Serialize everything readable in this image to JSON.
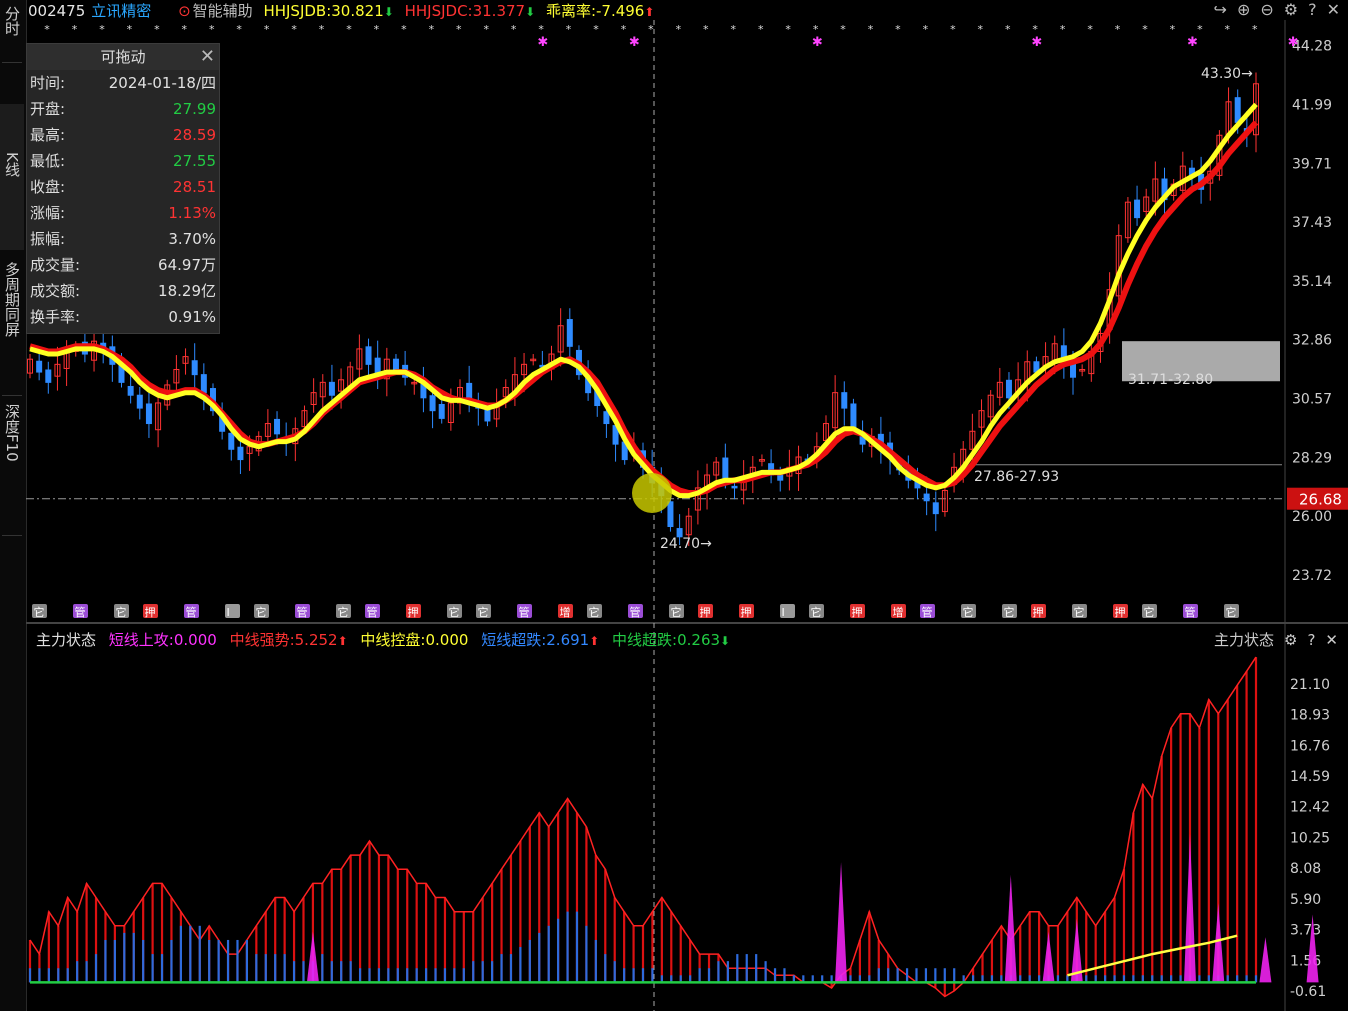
{
  "sidebar": {
    "tabs": [
      {
        "label": "分时"
      },
      {
        "label": "K线"
      },
      {
        "label": "多周期同屏"
      },
      {
        "label": "深度F10"
      }
    ]
  },
  "header": {
    "stock_code": "002475",
    "stock_name": "立讯精密",
    "assist_label": "智能辅助",
    "hhjsjdb": "HHJSJDB:30.821",
    "hhjsjdc": "HHJSJDC:31.377",
    "deviation": "乖离率:-7.496",
    "colors": {
      "code": "#e6e6e6",
      "name": "#2aa7ff",
      "db": "#ffff33",
      "dc": "#ff3333",
      "dev": "#ffff33"
    }
  },
  "info_panel": {
    "title": "可拖动",
    "rows": [
      {
        "label": "时间:",
        "value": "2024-01-18/四",
        "color": "#e0e0e0"
      },
      {
        "label": "开盘:",
        "value": "27.99",
        "color": "#22cc44"
      },
      {
        "label": "最高:",
        "value": "28.59",
        "color": "#ff3333"
      },
      {
        "label": "最低:",
        "value": "27.55",
        "color": "#22cc44"
      },
      {
        "label": "收盘:",
        "value": "28.51",
        "color": "#ff3333"
      },
      {
        "label": "涨幅:",
        "value": "1.13%",
        "color": "#ff3333"
      },
      {
        "label": "振幅:",
        "value": "3.70%",
        "color": "#e0e0e0"
      },
      {
        "label": "成交量:",
        "value": "64.97万",
        "color": "#e0e0e0"
      },
      {
        "label": "成交额:",
        "value": "18.29亿",
        "color": "#e0e0e0"
      },
      {
        "label": "换手率:",
        "value": "0.91%",
        "color": "#e0e0e0"
      }
    ]
  },
  "price_axis": [
    "44.28",
    "41.99",
    "39.71",
    "37.43",
    "35.14",
    "32.86",
    "30.57",
    "28.29",
    "26.00",
    "23.72"
  ],
  "current_price": "26.68",
  "annotations": {
    "high": "43.30",
    "low": "24.70",
    "zone_upper": "31.71-32.80",
    "zone_lower": "27.86-27.93"
  },
  "signal_tags": [
    "它",
    "管",
    "它",
    "押",
    "管",
    "I",
    "它",
    "管",
    "它",
    "管",
    "押",
    "它",
    "它",
    "管",
    "增",
    "它",
    "管",
    "它",
    "押",
    "押",
    "I",
    "它",
    "押",
    "增",
    "管",
    "它",
    "它",
    "押",
    "它",
    "押",
    "它",
    "管",
    "它"
  ],
  "indicator": {
    "name": "主力状态",
    "short_attack": "短线上攻:0.000",
    "mid_strong": "中线强势:5.252",
    "mid_control": "中线控盘:0.000",
    "short_oversold": "短线超跌:2.691",
    "mid_oversold": "中线超跌:0.263",
    "right_label": "主力状态",
    "axis": [
      "21.10",
      "18.93",
      "16.76",
      "14.59",
      "12.42",
      "10.25",
      "8.08",
      "5.90",
      "3.73",
      "1.56",
      "-0.61"
    ],
    "colors": {
      "name": "#e0e0e0",
      "short_attack": "#ff33ff",
      "mid_strong": "#ff3333",
      "mid_control": "#ffff33",
      "short_oversold": "#3388ff",
      "mid_oversold": "#22cc44"
    }
  },
  "chart_data": {
    "type": "candlestick",
    "ylim": [
      22.9,
      45.2
    ],
    "closes": [
      32.1,
      31.6,
      31.2,
      31.9,
      32.4,
      32.6,
      32.3,
      32.8,
      32.5,
      31.9,
      31.2,
      30.7,
      30.2,
      29.6,
      30.4,
      31.1,
      31.7,
      32.2,
      31.5,
      30.8,
      30.1,
      29.3,
      28.6,
      28.2,
      28.7,
      29.1,
      29.6,
      29.2,
      28.9,
      29.4,
      30.1,
      30.8,
      31.2,
      30.7,
      31.3,
      31.8,
      32.5,
      31.9,
      31.5,
      32.1,
      31.7,
      31.4,
      31.2,
      30.6,
      30.1,
      29.8,
      30.4,
      31.0,
      30.6,
      30.2,
      29.7,
      30.4,
      31.0,
      31.5,
      31.9,
      32.1,
      31.8,
      32.3,
      33.4,
      32.6,
      31.5,
      30.8,
      30.3,
      29.6,
      28.8,
      28.2,
      28.7,
      27.9,
      27.3,
      26.8,
      25.6,
      25.2,
      26.0,
      27.1,
      27.6,
      28.1,
      27.4,
      27.1,
      27.5,
      27.9,
      28.2,
      27.6,
      27.4,
      27.9,
      28.3,
      28.1,
      28.7,
      29.6,
      30.8,
      30.2,
      29.4,
      28.8,
      29.1,
      28.6,
      28.3,
      27.8,
      27.4,
      27.1,
      26.6,
      26.1,
      27.0,
      27.9,
      28.6,
      29.3,
      30.1,
      30.7,
      31.2,
      30.6,
      31.3,
      32.0,
      31.6,
      32.2,
      32.7,
      31.9,
      31.4,
      31.7,
      32.4,
      33.1,
      34.8,
      36.9,
      38.2,
      37.6,
      38.4,
      39.1,
      38.3,
      38.9,
      39.6,
      39.2,
      38.7,
      39.4,
      40.8,
      42.1,
      41.3,
      40.9,
      42.8
    ],
    "ma_yellow": [
      32.5,
      32.4,
      32.3,
      32.3,
      32.4,
      32.5,
      32.5,
      32.5,
      32.4,
      32.2,
      31.9,
      31.6,
      31.2,
      30.9,
      30.7,
      30.6,
      30.7,
      30.8,
      30.8,
      30.6,
      30.3,
      29.9,
      29.4,
      29.0,
      28.8,
      28.7,
      28.8,
      28.9,
      28.9,
      29.0,
      29.3,
      29.7,
      30.1,
      30.4,
      30.7,
      31.0,
      31.3,
      31.4,
      31.5,
      31.6,
      31.6,
      31.6,
      31.4,
      31.2,
      30.9,
      30.6,
      30.5,
      30.5,
      30.4,
      30.3,
      30.2,
      30.3,
      30.5,
      30.8,
      31.2,
      31.5,
      31.7,
      31.9,
      32.1,
      32.0,
      31.8,
      31.4,
      30.9,
      30.3,
      29.7,
      29.0,
      28.4,
      28.0,
      27.6,
      27.3,
      27.0,
      26.8,
      26.8,
      26.9,
      27.1,
      27.3,
      27.4,
      27.4,
      27.5,
      27.6,
      27.7,
      27.7,
      27.7,
      27.8,
      27.9,
      28.1,
      28.4,
      28.8,
      29.2,
      29.4,
      29.4,
      29.2,
      28.9,
      28.6,
      28.3,
      27.9,
      27.6,
      27.4,
      27.2,
      27.1,
      27.2,
      27.5,
      27.9,
      28.4,
      28.9,
      29.5,
      30.0,
      30.4,
      30.8,
      31.2,
      31.5,
      31.8,
      32.0,
      32.1,
      32.2,
      32.4,
      32.8,
      33.5,
      34.4,
      35.4,
      36.2,
      36.9,
      37.5,
      38.0,
      38.4,
      38.8,
      39.0,
      39.2,
      39.4,
      39.8,
      40.3,
      40.8,
      41.2,
      41.6,
      42.0
    ],
    "ma_red": [
      32.6,
      32.5,
      32.4,
      32.4,
      32.5,
      32.6,
      32.6,
      32.6,
      32.5,
      32.3,
      32.1,
      31.8,
      31.4,
      31.1,
      30.9,
      30.8,
      30.8,
      30.9,
      30.9,
      30.7,
      30.4,
      30.0,
      29.6,
      29.2,
      28.9,
      28.8,
      28.8,
      28.9,
      29.0,
      29.1,
      29.3,
      29.6,
      30.0,
      30.3,
      30.6,
      30.9,
      31.2,
      31.3,
      31.4,
      31.5,
      31.6,
      31.6,
      31.5,
      31.3,
      31.0,
      30.8,
      30.6,
      30.5,
      30.5,
      30.4,
      30.3,
      30.3,
      30.5,
      30.7,
      31.0,
      31.3,
      31.6,
      31.8,
      32.0,
      32.1,
      31.9,
      31.6,
      31.2,
      30.6,
      30.0,
      29.3,
      28.7,
      28.2,
      27.8,
      27.5,
      27.2,
      27.0,
      26.9,
      26.9,
      27.0,
      27.2,
      27.3,
      27.4,
      27.4,
      27.5,
      27.6,
      27.7,
      27.7,
      27.8,
      27.9,
      28.0,
      28.2,
      28.5,
      28.9,
      29.2,
      29.3,
      29.2,
      29.0,
      28.8,
      28.5,
      28.2,
      27.9,
      27.6,
      27.4,
      27.2,
      27.2,
      27.3,
      27.6,
      28.0,
      28.5,
      29.0,
      29.5,
      29.9,
      30.3,
      30.7,
      31.1,
      31.4,
      31.7,
      31.9,
      32.0,
      32.1,
      32.3,
      32.7,
      33.3,
      34.1,
      35.0,
      35.8,
      36.5,
      37.1,
      37.6,
      38.0,
      38.4,
      38.7,
      38.9,
      39.2,
      39.6,
      40.1,
      40.5,
      40.9,
      41.3
    ],
    "indicator_red": [
      3,
      2,
      5,
      4,
      6,
      5,
      7,
      6,
      5,
      4,
      4,
      5,
      6,
      7,
      7,
      6,
      5,
      4,
      3,
      4,
      3,
      2,
      2,
      3,
      4,
      5,
      6,
      6,
      5,
      6,
      7,
      7,
      8,
      8,
      9,
      9,
      10,
      9,
      9,
      8,
      8,
      7,
      7,
      6,
      6,
      5,
      5,
      5,
      6,
      7,
      8,
      9,
      10,
      11,
      12,
      11,
      12,
      13,
      12,
      11,
      9,
      8,
      6,
      5,
      4,
      4,
      5,
      6,
      5,
      4,
      3,
      2,
      2,
      2,
      1,
      1,
      1,
      1,
      1,
      0.5,
      0.5,
      0.5,
      0,
      0,
      0,
      -0.4,
      0.5,
      1,
      3,
      5,
      3,
      2,
      1,
      0.5,
      0,
      0,
      -0.4,
      -1,
      -0.6,
      0,
      1,
      2,
      3,
      4,
      3,
      4,
      5,
      5,
      4,
      4,
      5,
      6,
      5,
      4,
      5,
      6,
      8,
      12,
      14,
      13,
      16,
      18,
      19,
      19,
      18,
      20,
      19,
      20,
      21,
      22,
      23
    ],
    "indicator_blue": [
      1,
      1,
      1,
      1,
      1,
      1.5,
      1.5,
      2,
      3,
      3,
      3.5,
      3.5,
      3,
      2,
      2,
      3,
      4,
      4,
      4,
      3,
      3,
      3,
      3,
      3,
      2,
      2,
      2,
      2,
      1.5,
      1.5,
      1.5,
      2,
      1.5,
      1.5,
      1.5,
      1,
      1,
      1,
      1,
      1,
      1,
      1,
      1,
      1,
      1,
      1,
      1,
      1.5,
      1.5,
      1.5,
      2,
      2,
      2.5,
      3,
      3.5,
      4,
      4.5,
      5,
      5,
      4,
      3,
      2,
      1.5,
      1,
      1,
      1,
      1,
      0.5,
      0.5,
      0.5,
      0.5,
      1,
      1,
      1.5,
      1.5,
      2,
      2,
      2,
      1.5,
      1,
      1,
      0.5,
      0.5,
      0.5,
      0.5,
      0.5,
      0.5,
      0.5,
      0.5,
      0.5,
      1,
      1,
      1,
      1,
      1,
      1,
      1,
      1,
      1,
      0.5,
      0.5,
      0.5,
      0.5,
      0.5,
      0.5,
      0.5,
      0.5,
      0.5,
      0.5,
      0.5,
      0.5,
      0.5,
      0.5,
      0.5,
      0.5,
      0.5,
      0.5,
      0.5,
      0.5,
      0.5,
      0.5,
      0.5,
      0.5,
      0.5,
      0.5,
      0.5,
      0.5,
      0.5,
      0.5,
      0.5,
      0.5
    ],
    "indicator_magenta_peaks": [
      {
        "i": 30,
        "v": 3.6
      },
      {
        "i": 86,
        "v": 8.5
      },
      {
        "i": 104,
        "v": 7.6
      },
      {
        "i": 108,
        "v": 3.6
      },
      {
        "i": 111,
        "v": 4.5
      },
      {
        "i": 123,
        "v": 10.5
      },
      {
        "i": 126,
        "v": 5.6
      },
      {
        "i": 131,
        "v": 3.2
      },
      {
        "i": 136,
        "v": 4.8
      }
    ],
    "indicator_yellow_end": [
      0.5,
      1.0,
      1.5,
      2.0,
      2.4,
      2.8,
      3.3
    ]
  }
}
